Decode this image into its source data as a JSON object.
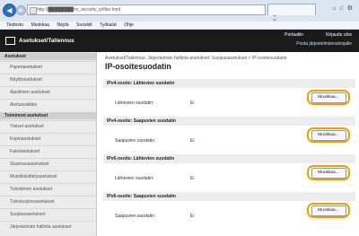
{
  "browser": {
    "url": "http://████████/m_security_ipfilter.html",
    "tab_label": "",
    "url_actions": "▾ ⊠ ✕"
  },
  "menu": [
    "Tiedosto",
    "Muokkaa",
    "Näytä",
    "Suosikit",
    "Työkalut",
    "Ohje"
  ],
  "header": {
    "title": "Asetukset/Tallennus",
    "portal_link": "Portaaliin",
    "logout_link": "Kirjaudu ulos",
    "admin_link": "Posta järjestelmänvalvojalle"
  },
  "sidebar": {
    "section1": "Asetukset",
    "items1": [
      "Paperiasetukset",
      "Näyttöasetukset",
      "Ajastimen asetukset",
      "Aloitusvalikko"
    ],
    "section2": "Toiminnot asetukset",
    "items2": [
      "Yleiset asetukset",
      "Kopioasetukset",
      "Faksiasetukset",
      "Skannausasetukset",
      "Muistikäsittelyasetukset",
      "Tulostimen asetukset",
      "Tulostusjonoasetukset",
      "Suojausasetukset",
      "Järjestelmän hallinta asetukset"
    ]
  },
  "content": {
    "breadcrumb": "Asetukset/Tallennus: Järjestelmän hallinta-asetukset: Suojausasetukset > IP-osoitesuodatin",
    "page_title": "IP-osoitesuodatin",
    "sections": [
      {
        "title": "IPv4-osoite: Lähtevien suodatin",
        "label": "Lähtevien suodatin:",
        "value": "Ei",
        "button": "Muokkaa..."
      },
      {
        "title": "IPv4-osoite: Saapuvien suodatin",
        "label": "Saapuvien suodatin:",
        "value": "Ei",
        "button": "Muokkaa..."
      },
      {
        "title": "IPv6-osoite: Lähtevien suodatin",
        "label": "Lähtevien suodatin:",
        "value": "Ei",
        "button": "Muokkaa..."
      },
      {
        "title": "IPv6-osoite: Saapuvien suodatin",
        "label": "Saapuvien suodatin:",
        "value": "Ei",
        "button": "Muokkaa..."
      }
    ]
  },
  "icons": {
    "back": "back-arrow-icon",
    "forward": "forward-arrow-icon",
    "toolbar": "home-star-gear-icons"
  },
  "colors": {
    "header_bg": "#1a1a1a",
    "highlight": "#f0a000",
    "sidebar_bg": "#e8e8e8"
  }
}
